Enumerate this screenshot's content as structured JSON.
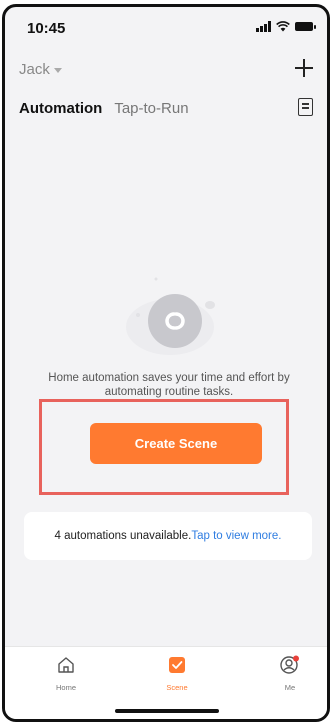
{
  "status_bar": {
    "time": "10:45"
  },
  "header": {
    "home_name": "Jack"
  },
  "tabs": {
    "automation_label": "Automation",
    "tap_to_run_label": "Tap-to-Run"
  },
  "empty_state": {
    "message": "Home automation saves your time and effort by automating routine tasks.",
    "create_button_label": "Create Scene"
  },
  "notice": {
    "text": "4 automations unavailable.",
    "link_text": "Tap to view more."
  },
  "bottom_nav": {
    "items": [
      {
        "label": "Home",
        "icon": "home-icon"
      },
      {
        "label": "Scene",
        "icon": "scene-icon"
      },
      {
        "label": "Me",
        "icon": "profile-icon"
      }
    ]
  },
  "colors": {
    "accent": "#ff7a30",
    "link": "#2f7de1",
    "highlight_border": "#e8625c",
    "background": "#f3f3f5"
  }
}
